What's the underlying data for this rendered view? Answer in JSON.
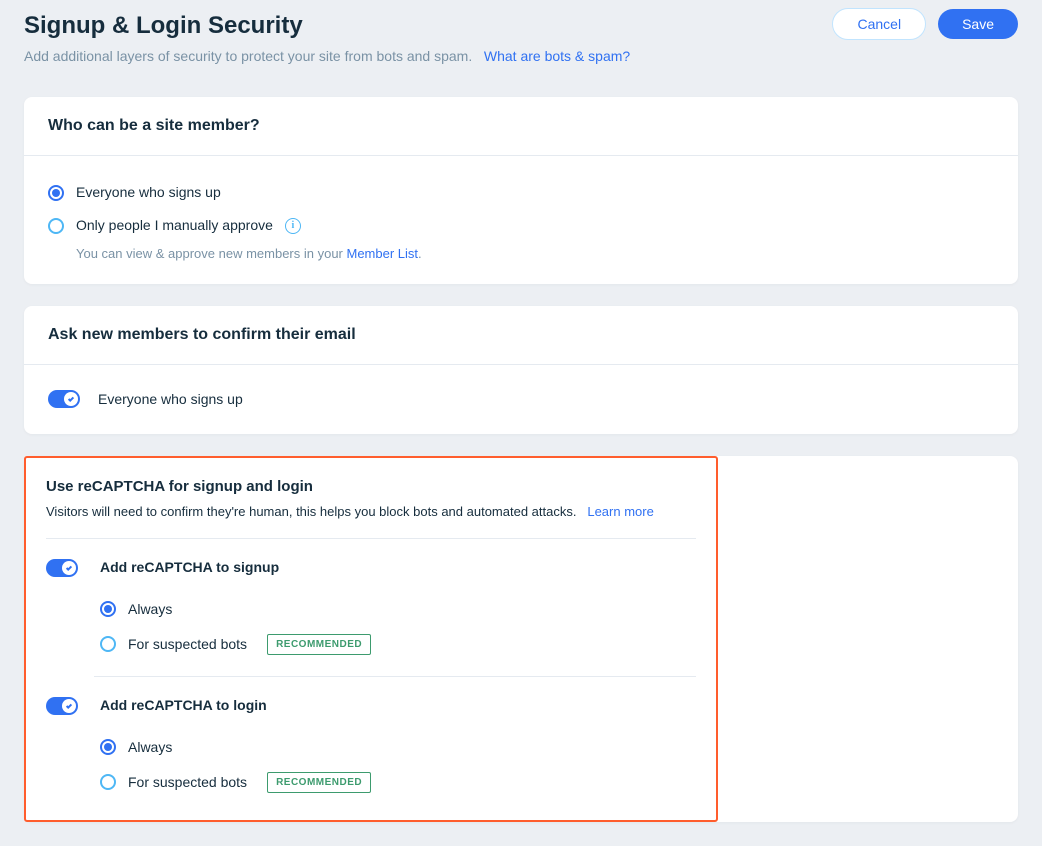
{
  "header": {
    "title": "Signup & Login Security",
    "subtitle": "Add additional layers of security to protect your site from bots and spam.",
    "help_link": "What are bots & spam?",
    "cancel_label": "Cancel",
    "save_label": "Save"
  },
  "section1": {
    "title": "Who can be a site member?",
    "option1": "Everyone who signs up",
    "option2": "Only people I manually approve",
    "helper_prefix": "You can view & approve new members in your ",
    "helper_link": "Member List",
    "helper_suffix": "."
  },
  "section2": {
    "title": "Ask new members to confirm their email",
    "toggle_label": "Everyone who signs up"
  },
  "section3": {
    "title": "Use reCAPTCHA for signup and login",
    "subtitle": "Visitors will need to confirm they're human, this helps you block bots and automated attacks.",
    "learn_more": "Learn more",
    "signup": {
      "title": "Add reCAPTCHA to signup",
      "opt_always": "Always",
      "opt_suspected": "For suspected bots",
      "badge": "RECOMMENDED"
    },
    "login": {
      "title": "Add reCAPTCHA to login",
      "opt_always": "Always",
      "opt_suspected": "For suspected bots",
      "badge": "RECOMMENDED"
    }
  }
}
